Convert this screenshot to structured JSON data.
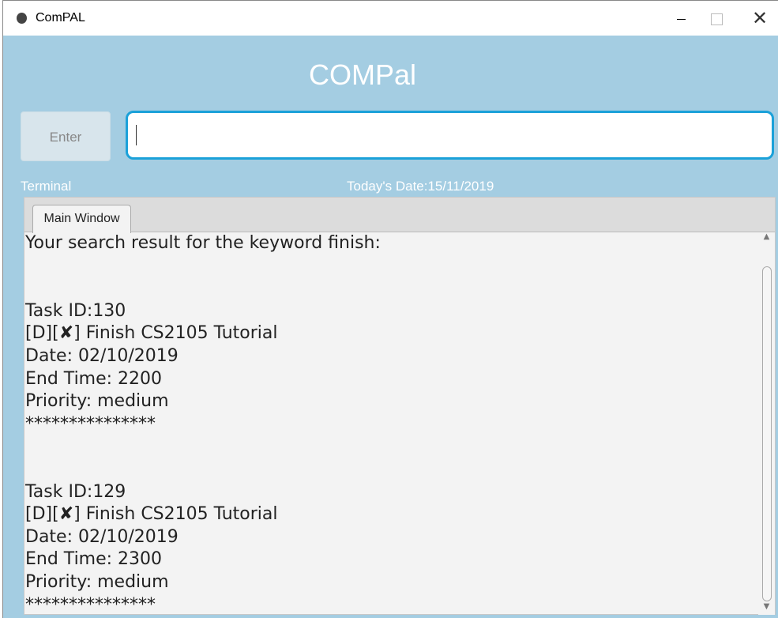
{
  "window": {
    "title": "ComPAL",
    "minimize": "",
    "maximize": "",
    "close": "✕"
  },
  "app": {
    "title": "COMPal",
    "enter_label": "Enter",
    "input_value": "",
    "terminal_label": "Terminal",
    "date_label": "Today's Date:15/11/2019"
  },
  "tabs": [
    {
      "label": "Main Window",
      "active": true
    }
  ],
  "output_lines": [
    "Your search result for the keyword finish:",
    "",
    "",
    "Task ID:130",
    "[D][✘] Finish CS2105 Tutorial",
    "Date: 02/10/2019",
    "End Time: 2200",
    "Priority: medium",
    "***************",
    "",
    "",
    "Task ID:129",
    "[D][✘] Finish CS2105 Tutorial",
    "Date: 02/10/2019",
    "End Time: 2300",
    "Priority: medium",
    "***************"
  ],
  "scrollbar": {
    "up": "▲",
    "down": "▼"
  }
}
